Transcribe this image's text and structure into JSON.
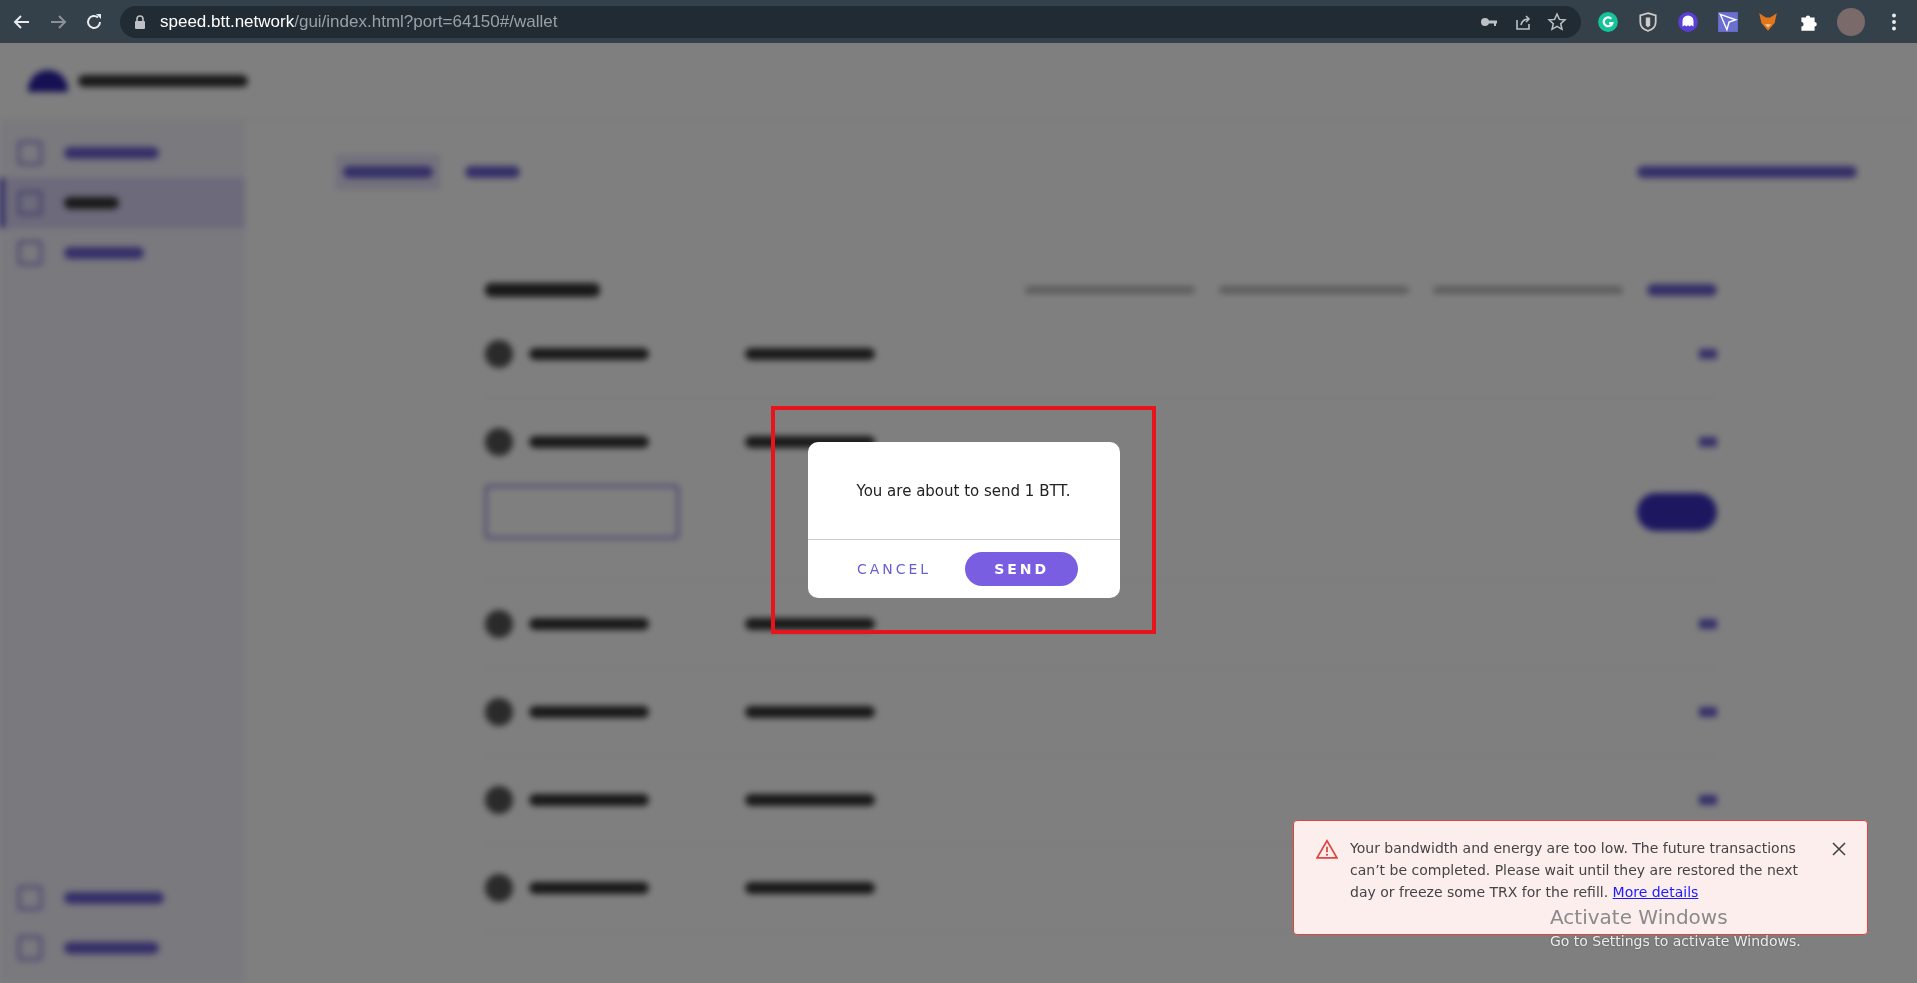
{
  "browser": {
    "url_host": "speed.btt.network",
    "url_path": "/gui/index.html?port=64150#/wallet"
  },
  "dialog": {
    "message": "You are about to send 1 BTT.",
    "cancel": "CANCEL",
    "confirm": "SEND"
  },
  "toast": {
    "message": "Your bandwidth and energy are too low. The future transactions can’t be completed. Please wait until they are restored the next day or freeze some TRX for the refill.",
    "link": "More details"
  },
  "os_notice": {
    "title": "Activate Windows",
    "subtitle": "Go to Settings to activate Windows."
  }
}
